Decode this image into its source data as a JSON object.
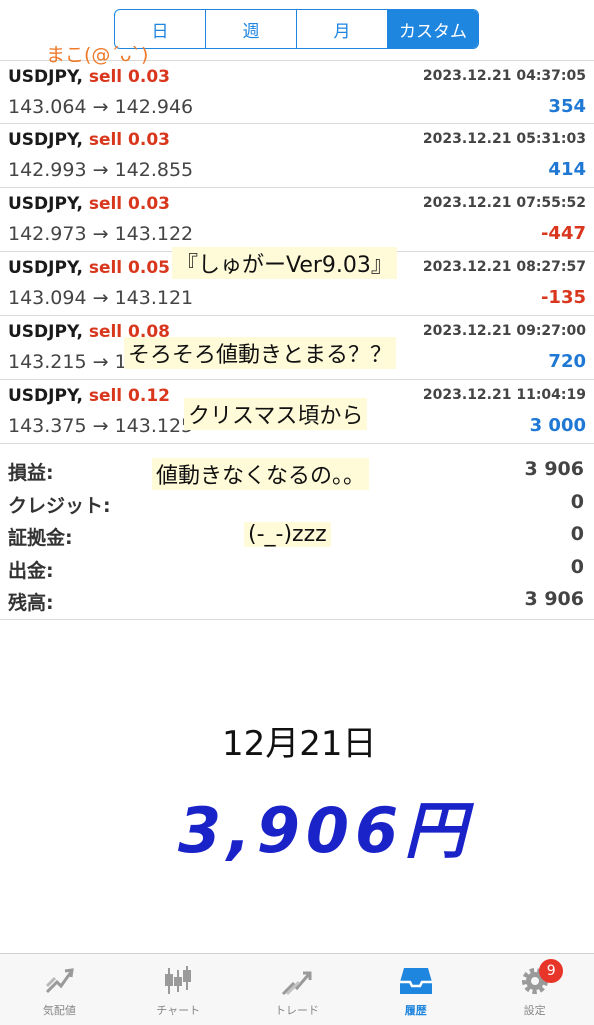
{
  "period_tabs": [
    "日",
    "週",
    "月",
    "カスタム"
  ],
  "trades": [
    {
      "symbol": "USDJPY,",
      "side": "sell 0.03",
      "datetime": "2023.12.21 04:37:05",
      "prices": "143.064 → 142.946",
      "profit": "354",
      "profit_sign": "pos"
    },
    {
      "symbol": "USDJPY,",
      "side": "sell 0.03",
      "datetime": "2023.12.21 05:31:03",
      "prices": "142.993 → 142.855",
      "profit": "414",
      "profit_sign": "pos"
    },
    {
      "symbol": "USDJPY,",
      "side": "sell 0.03",
      "datetime": "2023.12.21 07:55:52",
      "prices": "142.973 → 143.122",
      "profit": "-447",
      "profit_sign": "neg"
    },
    {
      "symbol": "USDJPY,",
      "side": "sell 0.05",
      "datetime": "2023.12.21 08:27:57",
      "prices": "143.094 → 143.121",
      "profit": "-135",
      "profit_sign": "neg"
    },
    {
      "symbol": "USDJPY,",
      "side": "sell 0.08",
      "datetime": "2023.12.21 09:27:00",
      "prices": "143.215 → 143.125",
      "profit": "720",
      "profit_sign": "pos"
    },
    {
      "symbol": "USDJPY,",
      "side": "sell 0.12",
      "datetime": "2023.12.21 11:04:19",
      "prices": "143.375 → 143.125",
      "profit": "3 000",
      "profit_sign": "pos"
    }
  ],
  "summary": [
    {
      "label": "損益:",
      "value": "3 906"
    },
    {
      "label": "クレジット:",
      "value": "0"
    },
    {
      "label": "証拠金:",
      "value": "0"
    },
    {
      "label": "出金:",
      "value": "0"
    },
    {
      "label": "残高:",
      "value": "3 906"
    }
  ],
  "handwriting": {
    "signature": "まこ(@´ᴗ`)",
    "memo1": "『しゅがーVer9.03』",
    "memo2": "そろそろ値動きとまる？？",
    "memo3": "クリスマス頃から",
    "memo4": "値動きなくなるの。。",
    "memo5": "(-_-)zzz",
    "date": "12月21日",
    "amount": "3,906円"
  },
  "tabbar": [
    {
      "label": "気配値",
      "icon": "quotes-icon"
    },
    {
      "label": "チャート",
      "icon": "chart-icon"
    },
    {
      "label": "トレード",
      "icon": "trade-icon"
    },
    {
      "label": "履歴",
      "icon": "history-icon"
    },
    {
      "label": "設定",
      "icon": "settings-icon"
    }
  ],
  "settings_badge": "9",
  "colors": {
    "accent": "#1f86e0",
    "loss": "#d9361e",
    "profit": "#1f78d4",
    "amount_ink": "#1a23c8"
  }
}
